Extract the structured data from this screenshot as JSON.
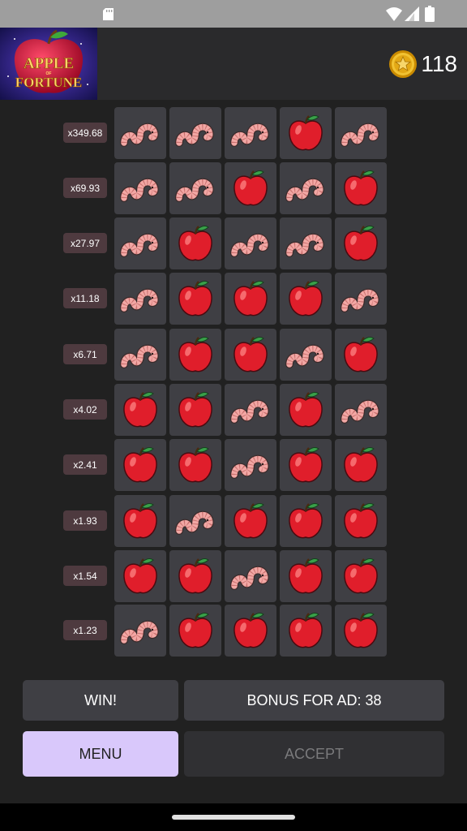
{
  "app": {
    "logo_text": "APPLE OF FORTUNE",
    "coins": "118",
    "coin_icon": "coin-icon"
  },
  "multipliers": [
    "x349.68",
    "x69.93",
    "x27.97",
    "x11.18",
    "x6.71",
    "x4.02",
    "x2.41",
    "x1.93",
    "x1.54",
    "x1.23"
  ],
  "grid": [
    [
      "worm",
      "worm",
      "worm",
      "apple",
      "worm"
    ],
    [
      "worm",
      "worm",
      "apple",
      "worm",
      "apple"
    ],
    [
      "worm",
      "apple",
      "worm",
      "worm",
      "apple"
    ],
    [
      "worm",
      "apple",
      "apple",
      "apple",
      "worm"
    ],
    [
      "worm",
      "apple",
      "apple",
      "worm",
      "apple"
    ],
    [
      "apple",
      "apple",
      "worm",
      "apple",
      "worm"
    ],
    [
      "apple",
      "apple",
      "worm",
      "apple",
      "apple"
    ],
    [
      "apple",
      "worm",
      "apple",
      "apple",
      "apple"
    ],
    [
      "apple",
      "apple",
      "worm",
      "apple",
      "apple"
    ],
    [
      "worm",
      "apple",
      "apple",
      "apple",
      "apple"
    ]
  ],
  "buttons": {
    "win": "WIN!",
    "bonus": "BONUS FOR AD: 38",
    "menu": "MENU",
    "accept": "ACCEPT"
  },
  "colors": {
    "background": "#212121",
    "cell": "#3f3f44",
    "multiplier_badge": "#4e3a3f",
    "menu_button": "#d9c8fb",
    "apple": "#e01e2b",
    "worm": "#f2a7a4"
  }
}
